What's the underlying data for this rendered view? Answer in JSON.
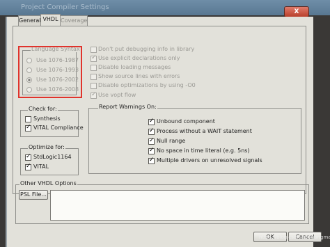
{
  "window": {
    "title": "Project Compiler Settings",
    "close_label": "X"
  },
  "tabs": [
    {
      "label": "General"
    },
    {
      "label": "VHDL"
    },
    {
      "label": "Coverage"
    }
  ],
  "language_syntax": {
    "legend": "Language Syntax",
    "options": [
      "Use 1076-1987",
      "Use 1076-1993",
      "Use 1076-2002",
      "Use 1076-2008"
    ],
    "selected": "Use 1076-2002"
  },
  "general_options": [
    {
      "label": "Don't put debugging info in library",
      "checked": false,
      "enabled": false
    },
    {
      "label": "Use explicit declarations only",
      "checked": true,
      "enabled": false
    },
    {
      "label": "Disable loading messages",
      "checked": false,
      "enabled": false
    },
    {
      "label": "Show source lines with errors",
      "checked": false,
      "enabled": false
    },
    {
      "label": "Disable optimizations by using -O0",
      "checked": false,
      "enabled": false
    },
    {
      "label": "Use vopt flow",
      "checked": true,
      "enabled": false
    }
  ],
  "check_for": {
    "legend": "Check for:",
    "items": [
      {
        "label": "Synthesis",
        "checked": false
      },
      {
        "label": "VITAL Compliance",
        "checked": true
      }
    ]
  },
  "optimize_for": {
    "legend": "Optimize for:",
    "items": [
      {
        "label": "StdLogic1164",
        "checked": true
      },
      {
        "label": "VITAL",
        "checked": true
      }
    ]
  },
  "report_warnings": {
    "legend": "Report Warnings On:",
    "items": [
      {
        "label": "Unbound component",
        "checked": true
      },
      {
        "label": "Process without a WAIT statement",
        "checked": true
      },
      {
        "label": "Null range",
        "checked": true
      },
      {
        "label": "No space in time literal (e.g. 5ns)",
        "checked": true
      },
      {
        "label": "Multiple drivers on unresolved signals",
        "checked": true
      }
    ]
  },
  "other_vhdl": {
    "legend": "Other VHDL Options",
    "psl_button": "PSL File...",
    "text_value": ""
  },
  "footer": {
    "ok_label": "OK",
    "cancel_label": "Cancel"
  },
  "watermark": "https://blog.csdn.net/hongmaokong"
}
